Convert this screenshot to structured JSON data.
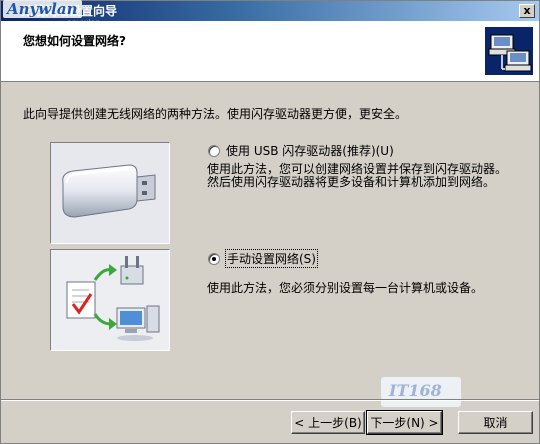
{
  "window": {
    "title": "无线网络设置向导",
    "watermark": "Anywlan",
    "watermark_sub": "anywlan",
    "close_glyph": "x"
  },
  "header": {
    "title": "您想如何设置网络?"
  },
  "intro": "此向导提供创建无线网络的两种方法。使用闪存驱动器更方便，更安全。",
  "options": [
    {
      "label": "使用 USB 闪存驱动器(推荐)(U)",
      "checked": false,
      "description": "使用此方法，您可以创建网络设置并保存到闪存驱动器。然后使用闪存驱动器将更多设备和计算机添加到网络。"
    },
    {
      "label": "手动设置网络(S)",
      "checked": true,
      "description": "使用此方法，您必须分别设置每一台计算机或设备。"
    }
  ],
  "buttons": {
    "back": "< 上一步(B)",
    "next": "下一步(N) >",
    "cancel": "取消"
  },
  "stamp": "IT168"
}
